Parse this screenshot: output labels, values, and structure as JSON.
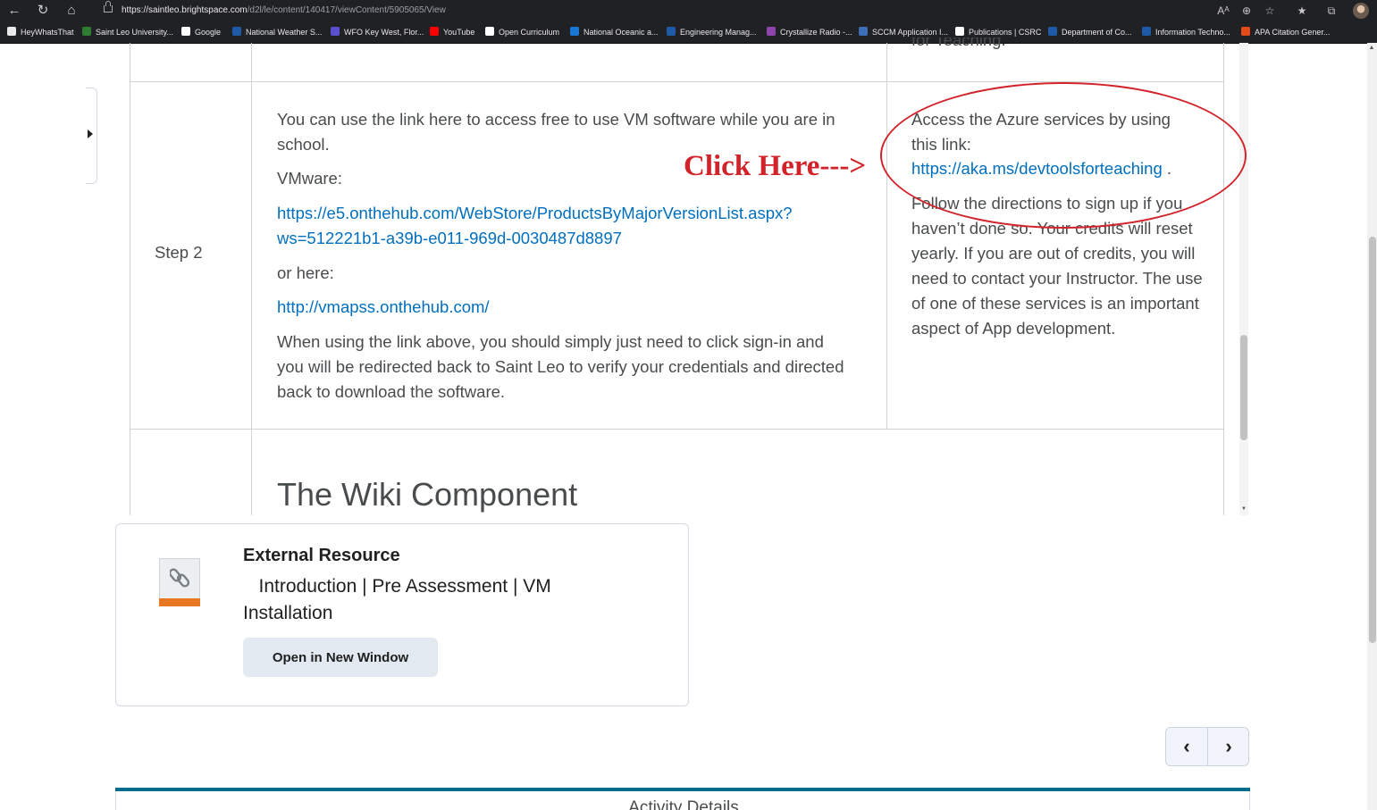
{
  "browser": {
    "url_host": "https://saintleo.brightspace.com",
    "url_path": "/d2l/le/content/140417/viewContent/5905065/View",
    "read_aloud_label": "Aᴬ"
  },
  "bookmarks": [
    {
      "label": "HeyWhatsThat",
      "color": "#e9e9e9"
    },
    {
      "label": "Saint Leo University...",
      "color": "#2e7d32"
    },
    {
      "label": "Google",
      "color": "#ffffff"
    },
    {
      "label": "National Weather S...",
      "color": "#1e5aa8"
    },
    {
      "label": "WFO Key West, Flor...",
      "color": "#5a4fcf"
    },
    {
      "label": "YouTube",
      "color": "#ff0000"
    },
    {
      "label": "Open Curriculum",
      "color": "#ffffff"
    },
    {
      "label": "National Oceanic a...",
      "color": "#1976d2"
    },
    {
      "label": "Engineering Manag...",
      "color": "#1e5aa8"
    },
    {
      "label": "Crystallize Radio -...",
      "color": "#8e44ad"
    },
    {
      "label": "SCCM Application I...",
      "color": "#3b6fb6"
    },
    {
      "label": "Publications | CSRC",
      "color": "#ffffff"
    },
    {
      "label": "Department of Co...",
      "color": "#1e5aa8"
    },
    {
      "label": "Information Techno...",
      "color": "#1e5aa8"
    },
    {
      "label": "APA Citation Gener...",
      "color": "#e64a19"
    }
  ],
  "table": {
    "prev_row_tail": "for Teaching.",
    "step_label": "Step 2",
    "middle": {
      "intro": "You can use the link here to access free to use VM software while you are in school.",
      "vmware_label": "VMware:",
      "vmware_link_line1": "https://e5.onthehub.com/WebStore/ProductsByMajorVersionList.aspx?",
      "vmware_link_line2": "ws=512221b1-a39b-e011-969d-0030487d8897",
      "or_here": "or here:",
      "alt_link": "http://vmapss.onthehub.com/",
      "instructions": "When using the link above, you should simply just need to click sign-in and you will be redirected back to Saint Leo to verify your credentials and directed back to download the software."
    },
    "right": {
      "access_text": "Access the Azure services by using this link:",
      "azure_link": "https://aka.ms/devtoolsforteaching",
      "azure_link_suffix": " .",
      "directions": "Follow the directions to sign up if you haven’t done so. Your credits will reset yearly. If you are out of credits, you will need to contact your Instructor. The use of one of these services is an important aspect of App development."
    },
    "next_heading": "The Wiki Component"
  },
  "annotation": {
    "click_here": "Click Here--->",
    "color": "#d2232a"
  },
  "external_resource": {
    "title": "External Resource",
    "subtitle": "Introduction | Pre Assessment | VM Installation",
    "button_label": "Open in New Window"
  },
  "pager": {
    "prev_icon": "‹",
    "next_icon": "›"
  },
  "activity": {
    "title": "Activity Details",
    "accent": "#006e8a"
  }
}
